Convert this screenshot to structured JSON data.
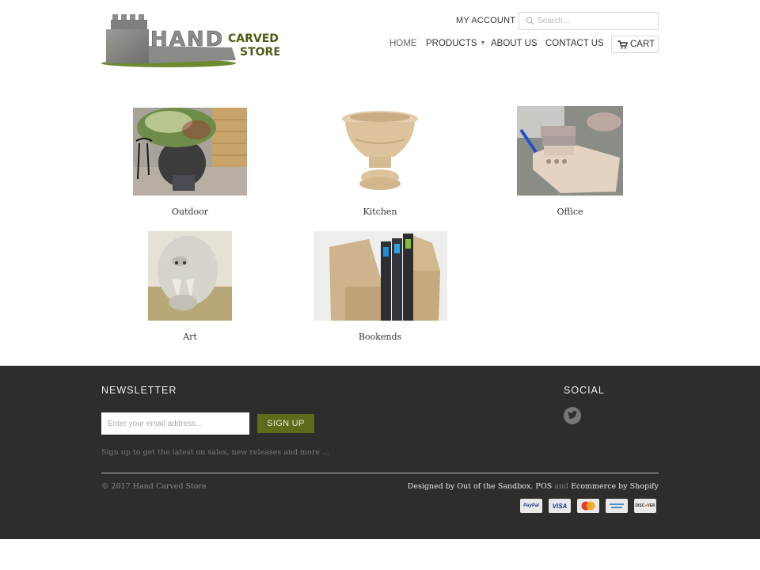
{
  "header": {
    "logo": {
      "word_main": "HAND",
      "word_top": "CARVED",
      "word_bottom": "STORE",
      "alt": "Hand Carved Store"
    },
    "my_account_label": "MY ACCOUNT",
    "search": {
      "placeholder": "Search...",
      "value": "",
      "icon": "search-icon"
    },
    "nav": [
      {
        "label": "HOME",
        "active": true
      },
      {
        "label": "PRODUCTS",
        "has_dropdown": true,
        "caret": "▼"
      },
      {
        "label": "ABOUT US"
      },
      {
        "label": "CONTACT US"
      }
    ],
    "cart": {
      "label": "CART",
      "icon": "cart-icon"
    }
  },
  "collections": [
    {
      "title": "Outdoor",
      "image": "stone planter with shrub on gravel"
    },
    {
      "title": "Kitchen",
      "image": "carved stone urn"
    },
    {
      "title": "Office",
      "image": "stone desk organizer with pen"
    },
    {
      "title": "Art",
      "image": "carved stone tiger head"
    },
    {
      "title": "Bookends",
      "image": "stone bookends with binders"
    }
  ],
  "footer": {
    "newsletter": {
      "title": "NEWSLETTER",
      "email_placeholder": "Enter your email address...",
      "email_value": "",
      "button_label": "SIGN UP",
      "note": "Sign up to get the latest on sales, new releases and more ..."
    },
    "social": {
      "title": "SOCIAL",
      "links": [
        {
          "name": "twitter",
          "icon": "twitter-icon"
        }
      ]
    },
    "copyright": "© 2017 Hand Carved Store",
    "credits": {
      "designed_by": "Designed by Out of the Sandbox",
      "separator": ".",
      "pos": "POS",
      "and": "and",
      "ecommerce": "Ecommerce by Shopify"
    },
    "payment_methods": [
      "PayPal",
      "VISA",
      "MasterCard",
      "American Express",
      "Discover"
    ]
  },
  "colors": {
    "footer_bg": "#2e2d2b",
    "signup_button": "#5f6a1b",
    "logo_green": "#4f5a14"
  }
}
